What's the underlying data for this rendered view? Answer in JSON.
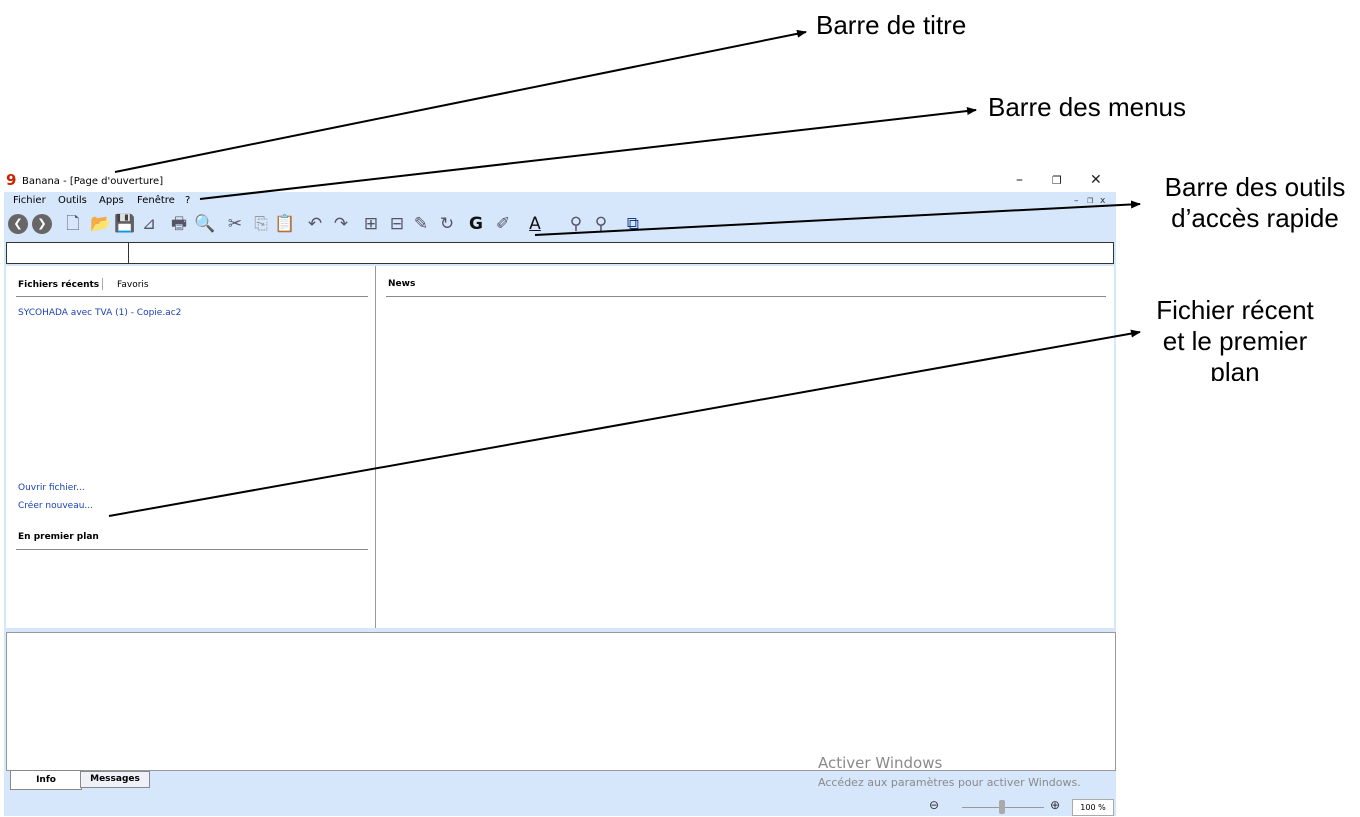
{
  "annotations": {
    "title_bar": "Barre de titre",
    "menu_bar": "Barre des menus",
    "toolbar_line1": "Barre des outils",
    "toolbar_line2": "d’accès rapide",
    "recent_line1": "Fichier récent",
    "recent_line2": "et le premier",
    "recent_line3": "plan"
  },
  "window": {
    "logo": "9",
    "title": "Banana - [Page d'ouverture]",
    "minimize": "–",
    "restore": "❐",
    "close": "✕"
  },
  "menu": {
    "items": [
      "Fichier",
      "Outils",
      "Apps",
      "Fenêtre",
      "?"
    ],
    "mdi_min": "–",
    "mdi_restore": "❐",
    "mdi_close": "x"
  },
  "toolbar": {
    "icons": [
      "back-icon",
      "forward-icon",
      "new-file-icon",
      "open-folder-icon",
      "save-icon",
      "pdf-icon",
      "print-icon",
      "print-preview-icon",
      "cut-icon",
      "copy-icon",
      "paste-icon",
      "undo-icon",
      "redo-icon",
      "insert-row-icon",
      "add-rows-icon",
      "rename-icon",
      "refresh-icon",
      "bold-icon",
      "highlight-color-icon",
      "text-color-icon",
      "find-icon",
      "find-next-icon",
      "window-menu-icon"
    ],
    "glyphs": {
      "back": "❮",
      "forward": "❯",
      "new": "🗋",
      "open": "📂",
      "save": "💾",
      "pdf": "⊿",
      "print": "🖶",
      "preview": "🔍",
      "cut": "✂",
      "copy": "⎘",
      "paste": "📋",
      "undo": "↶",
      "redo": "↷",
      "insert": "⊞",
      "add": "⊟",
      "rename": "✎",
      "refresh": "↻",
      "bold": "G",
      "highlight": "✐",
      "textcolor": "A",
      "find": "⚲",
      "findnext": "⚲",
      "window": "⧉"
    }
  },
  "left_pane": {
    "tab_recent": "Fichiers récents",
    "tab_favorites": "Favoris",
    "recent_files": [
      "SYCOHADA avec TVA (1) - Copie.ac2"
    ],
    "open_file": "Ouvrir fichier...",
    "create_new": "Créer nouveau...",
    "foreground_title": "En premier plan"
  },
  "news": {
    "title": "News"
  },
  "bottom_tabs": {
    "info": "Info",
    "messages": "Messages"
  },
  "watermark": {
    "line1": "Activer Windows",
    "line2": "Accédez aux paramètres pour activer Windows."
  },
  "status": {
    "zoom_out": "⊖",
    "zoom_in": "⊕",
    "zoom_level": "100 %",
    "zoom_slider_fraction": 0.5
  },
  "colors": {
    "chrome": "#d6e6fb",
    "link": "#1b3fb5",
    "logo": "#cc2200"
  }
}
